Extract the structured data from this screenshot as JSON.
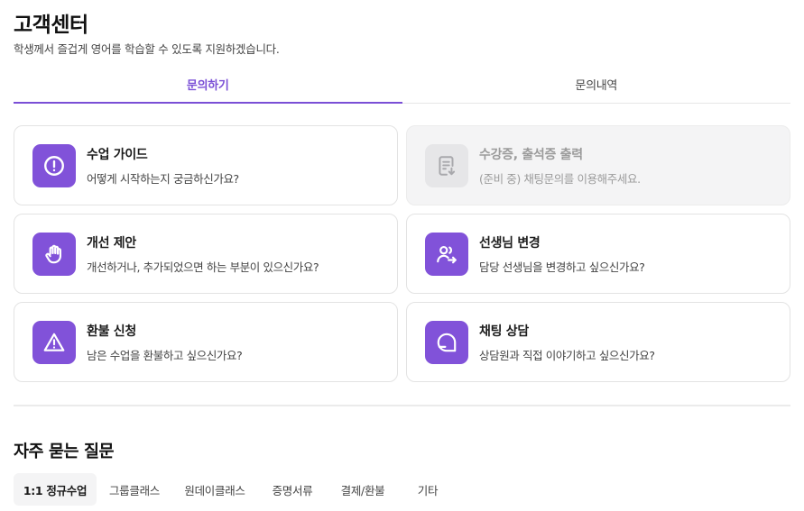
{
  "header": {
    "title": "고객센터",
    "subtitle": "학생께서 즐겁게 영어를 학습할 수 있도록 지원하겠습니다."
  },
  "tabs": [
    {
      "label": "문의하기",
      "active": true
    },
    {
      "label": "문의내역",
      "active": false
    }
  ],
  "cards": [
    {
      "title": "수업 가이드",
      "desc": "어떻게 시작하는지 궁금하신가요?",
      "icon": "exclamation-circle-icon",
      "disabled": false
    },
    {
      "title": "수강증, 출석증 출력",
      "desc": "(준비 중) 채팅문의를 이용해주세요.",
      "icon": "document-download-icon",
      "disabled": true
    },
    {
      "title": "개선 제안",
      "desc": "개선하거나, 추가되었으면 하는 부분이 있으신가요?",
      "icon": "raised-hand-icon",
      "disabled": false
    },
    {
      "title": "선생님 변경",
      "desc": "담당 선생님을 변경하고 싶으신가요?",
      "icon": "user-switch-icon",
      "disabled": false
    },
    {
      "title": "환불 신청",
      "desc": "남은 수업을 환불하고 싶으신가요?",
      "icon": "warning-triangle-icon",
      "disabled": false
    },
    {
      "title": "채팅 상담",
      "desc": "상담원과 직접 이야기하고 싶으신가요?",
      "icon": "chat-bubble-icon",
      "disabled": false
    }
  ],
  "colors": {
    "accent": "#7a4fd6",
    "icon_bg": "#8152d9",
    "disabled_bg": "#f4f4f5"
  },
  "faq": {
    "title": "자주 묻는 질문",
    "tabs": [
      {
        "label": "1:1 정규수업",
        "active": true
      },
      {
        "label": "그룹클래스",
        "active": false
      },
      {
        "label": "원데이클래스",
        "active": false
      },
      {
        "label": "증명서류",
        "active": false
      },
      {
        "label": "결제/환불",
        "active": false
      },
      {
        "label": "기타",
        "active": false
      }
    ]
  }
}
